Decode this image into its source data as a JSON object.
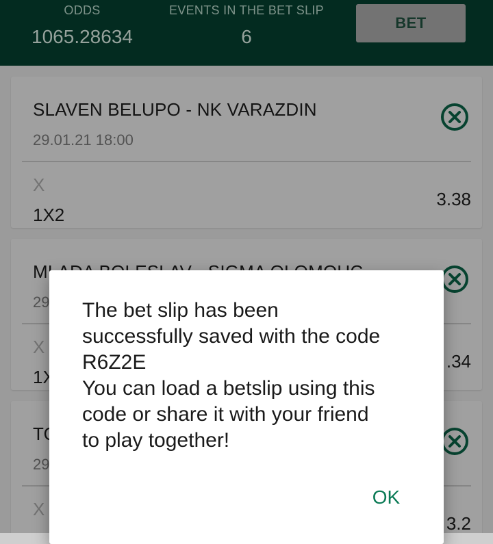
{
  "header": {
    "odds_label": "ODDS",
    "odds_value": "1065.28634",
    "events_label": "EVENTS IN THE BET SLIP",
    "events_value": "6",
    "bet_label": "BET"
  },
  "cards": [
    {
      "title": "SLAVEN BELUPO - NK VARAZDIN",
      "date": "29.01.21 18:00",
      "pick": "X",
      "market": "1X2",
      "odd": "3.38"
    },
    {
      "title": "MLADA BOLESLAV - SIGMA OLOMOUC",
      "date": "29",
      "pick": "X",
      "market": "1X",
      "odd": ".34"
    },
    {
      "title": "TO",
      "date": "29",
      "pick": "X",
      "market": "1X",
      "odd": "3.2"
    }
  ],
  "dialog": {
    "message": "The bet slip has been\nsuccessfully saved with the code\nR6Z2E\nYou can load a betslip using this\ncode or share it with your friend\nto play together!",
    "ok_label": "OK"
  },
  "colors": {
    "header_bg": "#043a2b",
    "accent": "#0a7a55",
    "remove_icon": "#0a5a40"
  }
}
